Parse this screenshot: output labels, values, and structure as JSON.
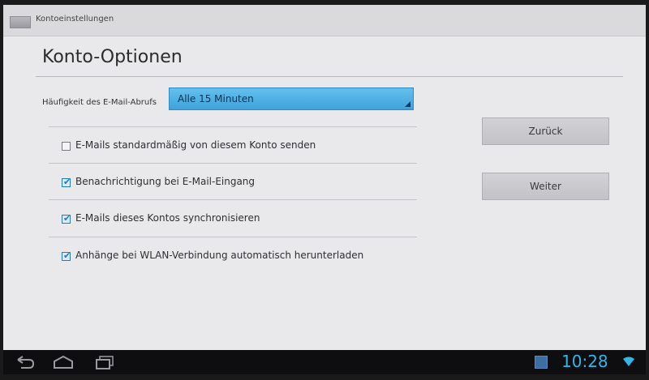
{
  "titlebar": {
    "title": "Kontoeinstellungen",
    "icon": "email-settings-icon"
  },
  "page": {
    "heading": "Konto-Optionen"
  },
  "frequency": {
    "label": "Häufigkeit des E-Mail-Abrufs",
    "selected": "Alle 15 Minuten"
  },
  "options": [
    {
      "label": "E-Mails standardmäßig von diesem Konto senden",
      "checked": false
    },
    {
      "label": "Benachrichtigung bei E-Mail-Eingang",
      "checked": true
    },
    {
      "label": "E-Mails dieses Kontos synchronisieren",
      "checked": true
    },
    {
      "label": "Anhänge bei WLAN-Verbindung automatisch herunterladen",
      "checked": true
    }
  ],
  "buttons": {
    "back": "Zurück",
    "next": "Weiter"
  },
  "statusbar": {
    "time": "10:28",
    "accent_color": "#33b5e5"
  }
}
